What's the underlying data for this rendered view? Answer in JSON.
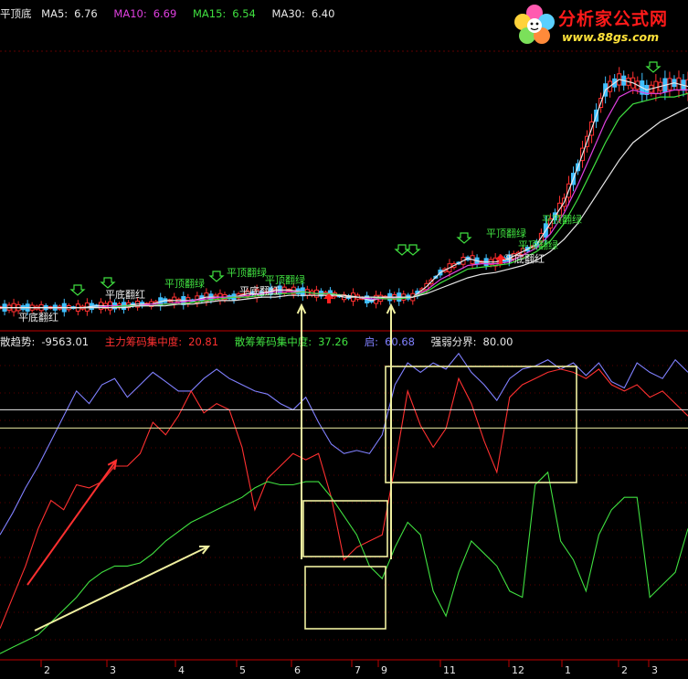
{
  "top_header": {
    "indicator_name": "平顶底",
    "ma5": {
      "label": "MA5:",
      "value": "6.76",
      "color": "#e8e8e8"
    },
    "ma10": {
      "label": "MA10:",
      "value": "6.69",
      "color": "#e040e0"
    },
    "ma15": {
      "label": "MA15:",
      "value": "6.54",
      "color": "#40e040"
    },
    "ma30": {
      "label": "MA30:",
      "value": "6.40",
      "color": "#e8e8e8"
    }
  },
  "bottom_header": {
    "trend": {
      "label": "散趋势:",
      "value": "-9563.01"
    },
    "main_conc": {
      "label": "主力筹码集中度:",
      "value": "20.81",
      "color": "#ff3030"
    },
    "retail_conc": {
      "label": "散筹筹码集中度:",
      "value": "37.26",
      "color": "#40e040"
    },
    "start": {
      "label": "启:",
      "value": "60.68",
      "color": "#8080ff"
    },
    "strength_boundary": {
      "label": "强弱分界:",
      "value": "80.00"
    }
  },
  "logo": {
    "text": "分析家公式网",
    "url": "www.88gs.com"
  },
  "signals": [
    {
      "text": "平顶翻绿",
      "color": "#40e040"
    },
    {
      "text": "平顶翻绿",
      "color": "#40e040"
    },
    {
      "text": "平顶翻绿",
      "color": "#40e040"
    },
    {
      "text": "平顶翻绿",
      "color": "#40e040"
    },
    {
      "text": "平顶翻绿",
      "color": "#40e040"
    },
    {
      "text": "平顶翻绿",
      "color": "#40e040"
    },
    {
      "text": "平底翻红",
      "color": "#e8e8e8"
    },
    {
      "text": "平底翻红",
      "color": "#e8e8e8"
    },
    {
      "text": "平底翻红",
      "color": "#e8e8e8"
    },
    {
      "text": "平底翻红",
      "color": "#e8e8e8"
    }
  ],
  "chart_data": {
    "type": "line",
    "panels": [
      "price",
      "indicator"
    ],
    "x_ticks": [
      "2",
      "3",
      "4",
      "5",
      "6",
      "7",
      "9",
      "11",
      "12",
      "1",
      "2",
      "3"
    ],
    "price_series": [
      {
        "name": "MA5",
        "color": "#e8e8e8",
        "values": [
          6.0,
          6.0,
          6.0,
          6.0,
          6.0,
          6.0,
          6.0,
          6.05,
          6.05,
          6.05,
          6.1,
          6.1,
          6.2,
          6.2,
          6.2,
          6.3,
          6.3,
          6.3,
          6.4,
          6.4,
          6.5,
          6.5,
          6.45,
          6.4,
          6.4,
          6.3,
          6.3,
          6.2,
          6.3,
          6.3,
          6.3,
          6.6,
          7.0,
          7.2,
          7.4,
          7.3,
          7.3,
          7.4,
          7.6,
          7.8,
          8.4,
          9.0,
          10.0,
          11.1,
          12.2,
          12.5,
          12.4,
          12.2,
          12.3,
          12.4,
          12.3
        ]
      },
      {
        "name": "MA10",
        "color": "#e040e0",
        "values": [
          6.0,
          6.0,
          6.0,
          6.0,
          6.0,
          6.0,
          6.0,
          6.0,
          6.05,
          6.05,
          6.05,
          6.1,
          6.1,
          6.15,
          6.2,
          6.25,
          6.3,
          6.3,
          6.35,
          6.4,
          6.45,
          6.45,
          6.45,
          6.4,
          6.4,
          6.35,
          6.3,
          6.25,
          6.25,
          6.3,
          6.3,
          6.5,
          6.8,
          7.0,
          7.2,
          7.25,
          7.25,
          7.3,
          7.5,
          7.7,
          8.1,
          8.7,
          9.5,
          10.4,
          11.3,
          12.0,
          12.2,
          12.1,
          12.1,
          12.2,
          12.2
        ]
      },
      {
        "name": "MA15",
        "color": "#40e040",
        "values": [
          6.0,
          6.0,
          6.0,
          6.0,
          6.0,
          6.0,
          6.0,
          6.0,
          6.0,
          6.05,
          6.05,
          6.05,
          6.1,
          6.1,
          6.15,
          6.2,
          6.25,
          6.3,
          6.3,
          6.35,
          6.4,
          6.4,
          6.45,
          6.4,
          6.4,
          6.35,
          6.3,
          6.3,
          6.25,
          6.25,
          6.3,
          6.45,
          6.7,
          6.9,
          7.1,
          7.15,
          7.2,
          7.25,
          7.4,
          7.6,
          7.9,
          8.4,
          9.1,
          9.9,
          10.7,
          11.4,
          11.8,
          11.9,
          12.0,
          12.0,
          12.1
        ]
      },
      {
        "name": "MA30",
        "color": "#e8e8e8",
        "values": [
          6.0,
          6.0,
          6.0,
          6.0,
          6.0,
          6.0,
          6.0,
          6.0,
          6.0,
          6.0,
          6.05,
          6.05,
          6.05,
          6.1,
          6.1,
          6.15,
          6.2,
          6.2,
          6.25,
          6.3,
          6.3,
          6.35,
          6.35,
          6.35,
          6.35,
          6.35,
          6.3,
          6.3,
          6.3,
          6.3,
          6.3,
          6.4,
          6.55,
          6.7,
          6.85,
          6.95,
          7.0,
          7.1,
          7.2,
          7.35,
          7.6,
          7.95,
          8.4,
          9.0,
          9.6,
          10.2,
          10.7,
          11.0,
          11.3,
          11.5,
          11.7
        ]
      }
    ],
    "indicator_series": [
      {
        "name": "启",
        "color": "#8080ff",
        "values": [
          40,
          47,
          55,
          62,
          70,
          78,
          86,
          82,
          88,
          90,
          84,
          88,
          92,
          89,
          86,
          86,
          90,
          93,
          90,
          88,
          86,
          85,
          82,
          80,
          84,
          76,
          69,
          66,
          67,
          66,
          72,
          88,
          95,
          92,
          95,
          93,
          98,
          92,
          88,
          83,
          90,
          93,
          94,
          96,
          93,
          95,
          91,
          95,
          89,
          87,
          95,
          92,
          90,
          96,
          92
        ]
      },
      {
        "name": "主力筹码集中度",
        "color": "#ff3030",
        "values": [
          10,
          20,
          30,
          42,
          51,
          48,
          56,
          55,
          57,
          62,
          62,
          66,
          76,
          72,
          78,
          86,
          79,
          82,
          80,
          68,
          48,
          58,
          62,
          66,
          64,
          66,
          52,
          32,
          36,
          38,
          40,
          62,
          86,
          75,
          68,
          74,
          90,
          82,
          70,
          60,
          84,
          88,
          90,
          92,
          93,
          92,
          90,
          93,
          88,
          86,
          88,
          84,
          86,
          82,
          78
        ]
      },
      {
        "name": "散筹筹码集中度",
        "color": "#40e040",
        "values": [
          2,
          4,
          6,
          8,
          12,
          16,
          20,
          25,
          28,
          30,
          30,
          31,
          34,
          38,
          41,
          44,
          46,
          48,
          50,
          52,
          55,
          57,
          56,
          56,
          57,
          57,
          52,
          46,
          40,
          30,
          26,
          36,
          44,
          40,
          22,
          14,
          28,
          38,
          34,
          30,
          22,
          20,
          56,
          60,
          38,
          32,
          22,
          40,
          48,
          52,
          52,
          20,
          24,
          28,
          42
        ]
      },
      {
        "name": "强弱分界",
        "color": "#e8e8e8",
        "values": [
          80,
          80,
          80,
          80,
          80,
          80,
          80,
          80,
          80,
          80,
          80,
          80,
          80,
          80,
          80,
          80,
          80,
          80,
          80,
          80,
          80,
          80,
          80,
          80,
          80,
          80,
          80,
          80,
          80,
          80,
          80,
          80,
          80,
          80,
          80,
          80,
          80,
          80,
          80,
          80,
          80,
          80,
          80,
          80,
          80,
          80,
          80,
          80,
          80,
          80,
          80,
          80,
          80,
          80,
          80
        ]
      }
    ],
    "indicator_ylim": [
      0,
      100
    ],
    "price_ylim": [
      5.6,
      13.2
    ]
  }
}
